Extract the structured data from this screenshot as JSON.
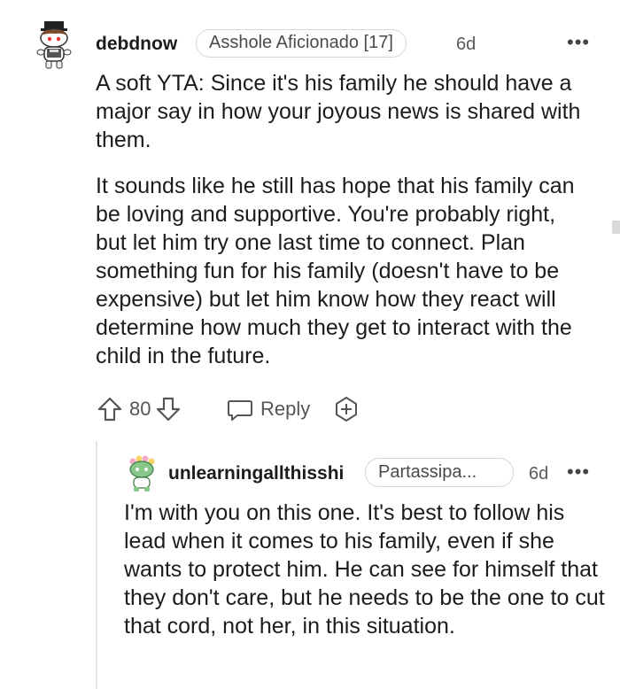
{
  "comment": {
    "author": "debdnow",
    "flair": "Asshole Aficionado [17]",
    "age": "6d",
    "more_label": "•••",
    "paragraphs": [
      "A soft YTA: Since it's his family he should have a major say in how your joyous news is shared with them.",
      "It sounds like he still has hope that his family can be loving and supportive. You're probably right, but let him try one last time to connect. Plan something fun for his family (doesn't have to be expensive) but let him know how they react will determine how much they get to interact with the child in the future."
    ],
    "vote_count": "80",
    "reply_label": "Reply",
    "icons": {
      "avatar": "snoo-avatar-top-hat",
      "upvote": "upvote-arrow-icon",
      "downvote": "downvote-arrow-icon",
      "reply": "speech-bubble-icon",
      "award": "award-plus-icon"
    }
  },
  "reply": {
    "author": "unlearningallthisshi",
    "flair": "Partassipa...",
    "age": "6d",
    "more_label": "•••",
    "text": "I'm with you on this one. It's best to follow his lead when it comes to his family, even if she wants to protect him. He can see for himself that they don't care, but he needs to be the one to cut that cord, not her, in this situation.",
    "icons": {
      "avatar": "snoo-avatar-flower"
    }
  },
  "colors": {
    "text": "#1c1c1c",
    "muted": "#555555",
    "border": "#d7d7d7",
    "avatar_green": "#86c88a"
  }
}
